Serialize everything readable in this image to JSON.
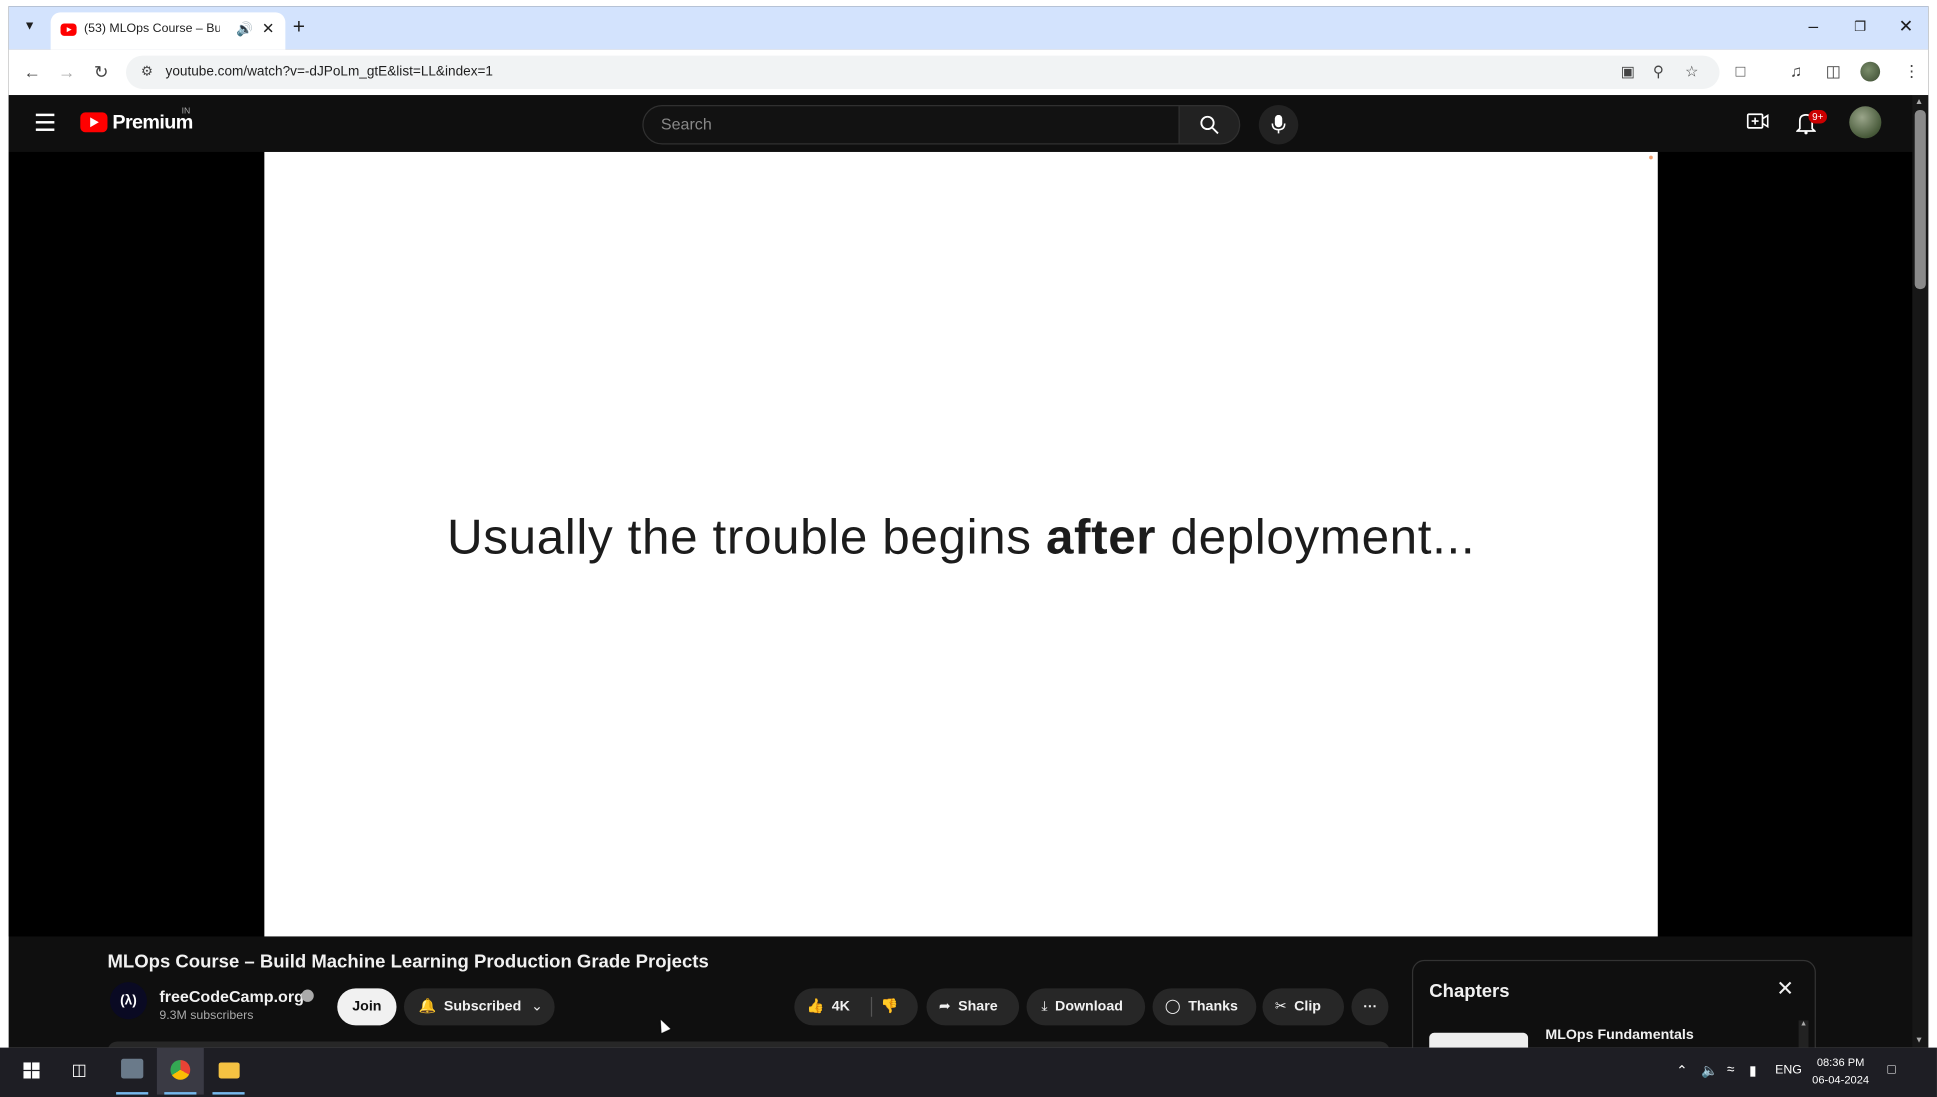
{
  "browser": {
    "tab_title": "(53) MLOps Course – Build",
    "url": "youtube.com/watch?v=-dJPoLm_gtE&list=LL&index=1"
  },
  "youtube": {
    "logo_text": "Premium",
    "country_code": "IN",
    "search_placeholder": "Search",
    "notification_count": "9+"
  },
  "video": {
    "slide_text_before": "Usually the trouble begins ",
    "slide_text_bold": "after",
    "slide_text_after": " deployment...",
    "title": "MLOps Course – Build Machine Learning Production Grade Projects",
    "channel_name": "freeCodeCamp.org",
    "subscribers": "9.3M subscribers",
    "join_label": "Join",
    "subscribed_label": "Subscribed",
    "like_count": "4K",
    "share_label": "Share",
    "download_label": "Download",
    "thanks_label": "Thanks",
    "clip_label": "Clip"
  },
  "chapters": {
    "heading": "Chapters",
    "items": [
      "MLOps Fundamentals"
    ]
  },
  "taskbar": {
    "language": "ENG",
    "time": "08:36 PM",
    "date": "06-04-2024"
  }
}
